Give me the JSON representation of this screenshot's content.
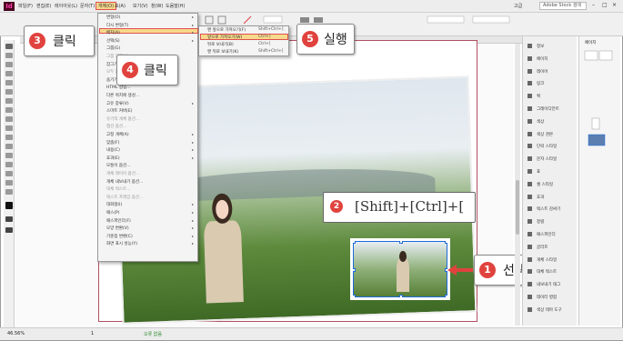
{
  "app": {
    "logo": "Id"
  },
  "menubar": {
    "items": [
      "파일(F)",
      "편집(E)",
      "레이아웃(L)",
      "문자(T)",
      "개체(O)",
      "표(A)",
      "보기(V)",
      "창(W)",
      "도움말(H)"
    ],
    "active_index": 4,
    "search": "Adobe Stock 검색",
    "workspace": "고급"
  },
  "dropdown": {
    "items": [
      {
        "label": "변형(O)",
        "arrow": true
      },
      {
        "label": "다시 변형(T)",
        "arrow": true
      },
      {
        "label": "배치(A)",
        "arrow": true,
        "highlight": true
      },
      {
        "label": "선택(S)",
        "arrow": true
      },
      {
        "label": "그룹(G)",
        "dim": false
      },
      {
        "label": "그룹 해제(U)",
        "dim": true
      },
      {
        "label": "잠그기(L)",
        "dim": false
      },
      {
        "label": "모두 잠금 해제",
        "dim": true
      },
      {
        "label": "숨기기",
        "dim": false
      },
      {
        "label": "HTML 삽입...",
        "dim": false
      },
      {
        "label": "다른 위치에 생성...",
        "dim": false
      },
      {
        "label": "고유 종류(V)",
        "arrow": true
      },
      {
        "label": "스마트 커버(E)",
        "dim": false
      },
      {
        "label": "유기적 개체 옵션...",
        "dim": true
      },
      {
        "label": "캡션 옵션...",
        "dim": true
      },
      {
        "label": "고정 개체(A)",
        "arrow": true
      },
      {
        "label": "맞춤(F)",
        "arrow": true
      },
      {
        "label": "내용(C)",
        "arrow": true
      },
      {
        "label": "효과(E)",
        "arrow": true
      },
      {
        "label": "모퉁이 옵션...",
        "dim": false
      },
      {
        "label": "개체 레이어 옵션...",
        "dim": true
      },
      {
        "label": "개체 내보내기 옵션...",
        "dim": false
      },
      {
        "label": "대체 텍스트...",
        "dim": true
      },
      {
        "label": "텍스트 프레임 옵션...",
        "dim": true
      },
      {
        "label": "대화형(I)",
        "arrow": true
      },
      {
        "label": "패스(P)",
        "arrow": true
      },
      {
        "label": "패스파인더(F)",
        "arrow": true
      },
      {
        "label": "모양 변환(V)",
        "arrow": true
      },
      {
        "label": "기준점 변환(C)",
        "arrow": true
      },
      {
        "label": "화면 표시 성능(Y)",
        "arrow": true
      }
    ]
  },
  "submenu": {
    "items": [
      {
        "label": "맨 앞으로 가져오기(F)",
        "key": "Shift+Ctrl+]"
      },
      {
        "label": "앞으로 가져오기(W)",
        "key": "Ctrl+]",
        "highlight": true
      },
      {
        "label": "뒤로 보내기(B)",
        "key": "Ctrl+["
      },
      {
        "label": "맨 뒤로 보내기(K)",
        "key": "Shift+Ctrl+["
      }
    ]
  },
  "annotations": {
    "step3": {
      "num": "3",
      "label": "클릭"
    },
    "step4": {
      "num": "4",
      "label": "클릭"
    },
    "step5": {
      "num": "5",
      "label": "실행"
    },
    "step1": {
      "num": "1",
      "label": "선택"
    },
    "step2": {
      "num": "2",
      "shortcut": "[Shift]+[Ctrl]+["
    }
  },
  "right_panel": {
    "items": [
      "정보",
      "페이지",
      "레이어",
      "링크",
      "획",
      "그레이디언트",
      "색상",
      "색상 견본",
      "단락 스타일",
      "문자 스타일",
      "표",
      "셀 스타일",
      "효과",
      "텍스트 감싸기",
      "정렬",
      "패스파인더",
      "글리프",
      "개체 스타일",
      "대체 텍스트",
      "내보내기 태그",
      "데이터 병합",
      "색상 테마 도구"
    ],
    "pages_label": "페이지"
  },
  "statusbar": {
    "zoom": "46.56%",
    "page": "1",
    "status": "오류 없음"
  },
  "colors": {
    "accent_red": "#e0433e",
    "highlight": "#f6d98a",
    "selection_blue": "#1c6bd8"
  }
}
